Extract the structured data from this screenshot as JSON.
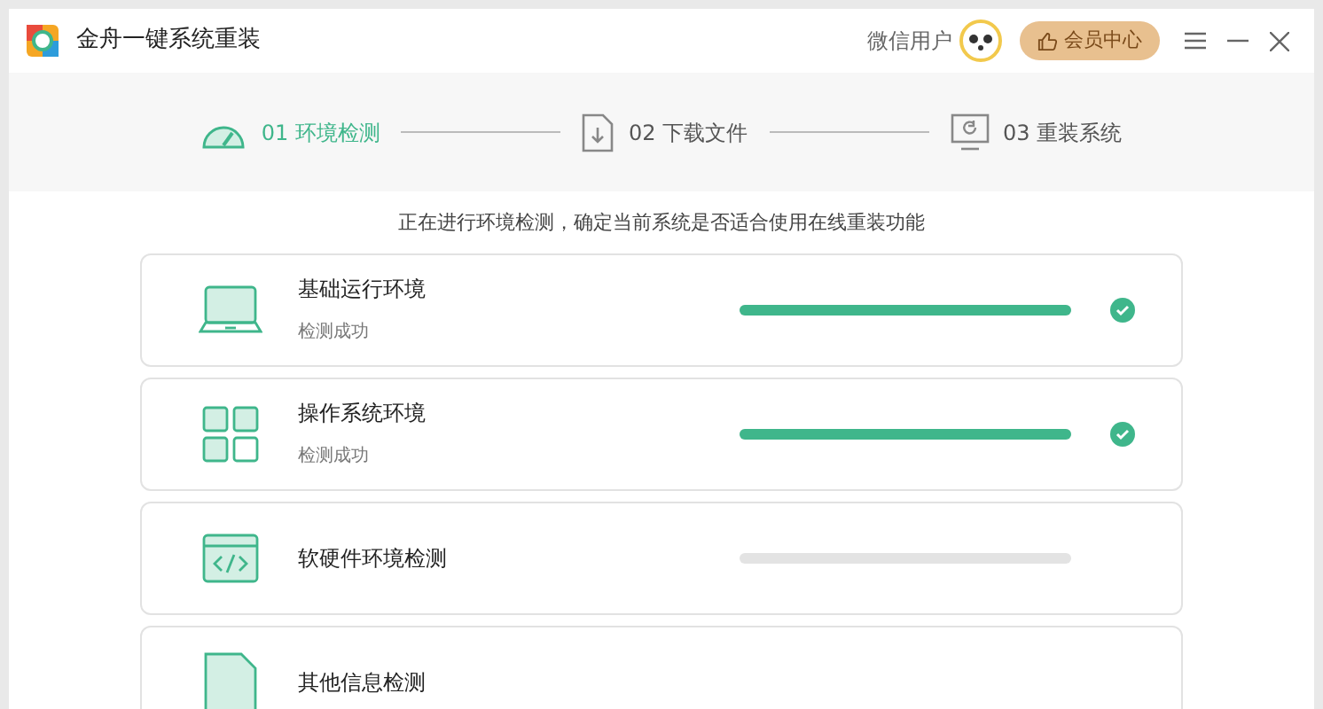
{
  "window": {
    "title": "金舟一键系统重装",
    "user": "微信用户",
    "vip_button": "会员中心"
  },
  "steps": [
    {
      "kind": "gauge",
      "label": "01 环境检测",
      "selected": true
    },
    {
      "kind": "download",
      "label": "02 下载文件",
      "selected": false
    },
    {
      "kind": "reinstall",
      "label": "03 重装系统",
      "selected": false
    }
  ],
  "message": "正在进行环境检测，确定当前系统是否适合使用在线重装功能",
  "checks": [
    {
      "kind": "laptop",
      "title": "基础运行环境",
      "status": "检测成功",
      "level": 1,
      "done": true
    },
    {
      "kind": "grid",
      "title": "操作系统环境",
      "status": "检测成功",
      "level": 1,
      "done": true
    },
    {
      "kind": "code",
      "title": "软硬件环境检测",
      "level": 0,
      "done": false
    },
    {
      "kind": "document",
      "title": "其他信息检测"
    }
  ]
}
